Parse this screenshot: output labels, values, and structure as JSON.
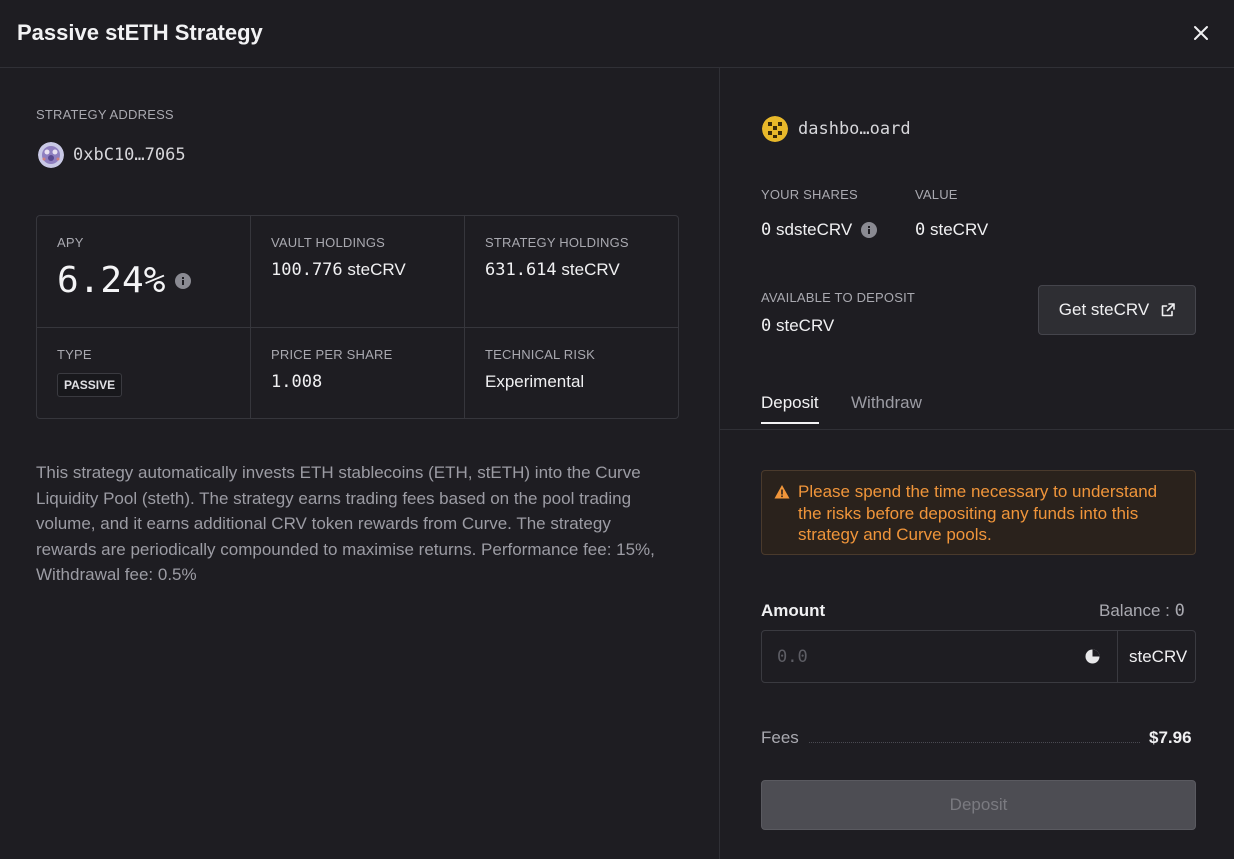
{
  "modal": {
    "title": "Passive stETH Strategy"
  },
  "strategy": {
    "address_label": "STRATEGY ADDRESS",
    "address": "0xbC10…7065",
    "stats": {
      "apy_label": "APY",
      "apy": "6.24%",
      "vault_holdings_label": "VAULT HOLDINGS",
      "vault_holdings": "100.776",
      "vault_holdings_unit": "steCRV",
      "strategy_holdings_label": "STRATEGY HOLDINGS",
      "strategy_holdings": "631.614",
      "strategy_holdings_unit": "steCRV",
      "type_label": "TYPE",
      "type": "PASSIVE",
      "price_per_share_label": "PRICE PER SHARE",
      "price_per_share": "1.008",
      "technical_risk_label": "TECHNICAL RISK",
      "technical_risk": "Experimental"
    },
    "description": "This strategy automatically invests ETH stablecoins (ETH, stETH) into the Curve Liquidity Pool (steth). The strategy earns trading fees based on the pool trading volume, and it earns additional CRV token rewards from Curve. The strategy rewards are periodically compounded to maximise returns. Performance fee: 15%, Withdrawal fee: 0.5%"
  },
  "account": {
    "name": "dashbo…oard",
    "your_shares_label": "YOUR SHARES",
    "your_shares": "0",
    "your_shares_unit": "sdsteCRV",
    "value_label": "VALUE",
    "value": "0",
    "value_unit": "steCRV",
    "available_label": "AVAILABLE TO DEPOSIT",
    "available": "0",
    "available_unit": "steCRV",
    "get_button": "Get steCRV"
  },
  "tabs": {
    "deposit": "Deposit",
    "withdraw": "Withdraw"
  },
  "warning": {
    "text": "Please spend the time necessary to understand the risks before depositing any funds into this strategy and Curve pools."
  },
  "form": {
    "amount_label": "Amount",
    "balance_label": "Balance :",
    "balance": "0",
    "amount_placeholder": "0.0",
    "unit": "steCRV",
    "fees_label": "Fees",
    "fees": "$7.96",
    "submit": "Deposit"
  },
  "colors": {
    "background": "#1e1d22",
    "warning": "#f0953a",
    "button_disabled": "#4d4d53"
  },
  "icons": [
    "close-icon",
    "info-icon",
    "external-link-icon",
    "warning-icon",
    "max-icon",
    "avatar"
  ]
}
